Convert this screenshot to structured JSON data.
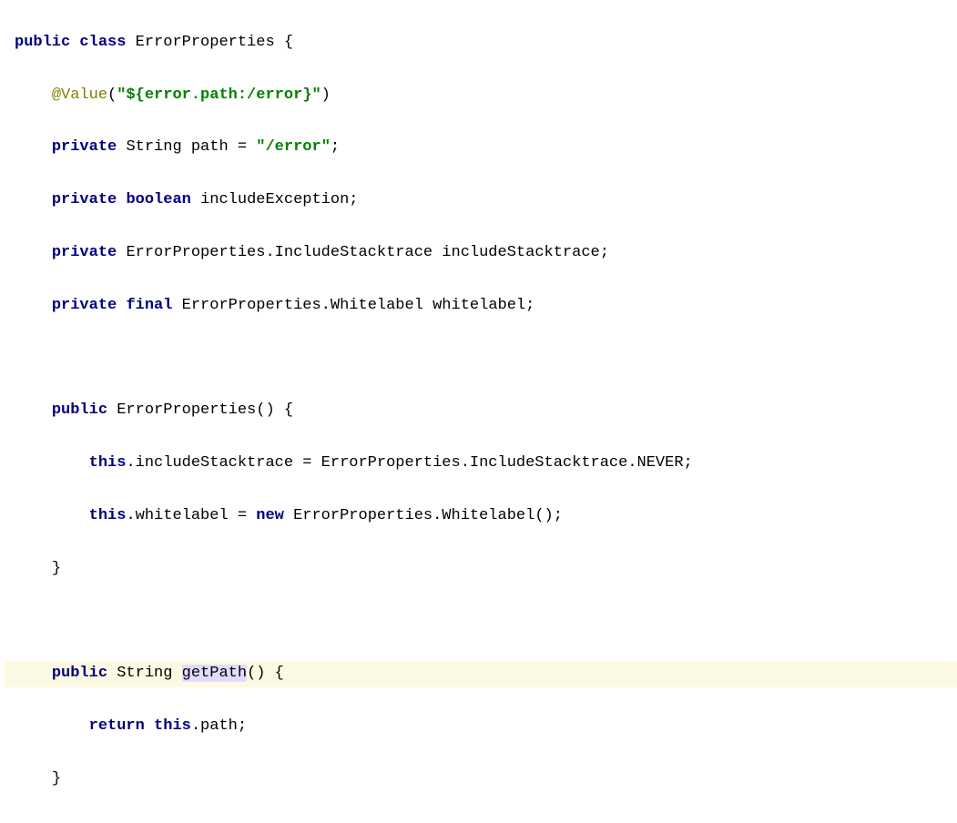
{
  "code": {
    "l1": {
      "kw1": "public",
      "kw2": "class",
      "name": "ErrorProperties",
      "brace": "{"
    },
    "l2": {
      "ann": "@Value",
      "open": "(",
      "str": "\"${error.path:/error}\"",
      "close": ")"
    },
    "l3": {
      "kw": "private",
      "type": "String",
      "name": "path",
      "eq": "=",
      "str": "\"/error\"",
      "semi": ";"
    },
    "l4": {
      "kw1": "private",
      "kw2": "boolean",
      "name": "includeException;"
    },
    "l5": {
      "kw": "private",
      "type": "ErrorProperties.IncludeStacktrace",
      "name": "includeStacktrace;"
    },
    "l6": {
      "kw1": "private",
      "kw2": "final",
      "type": "ErrorProperties.Whitelabel",
      "name": "whitelabel;"
    },
    "l8": {
      "kw": "public",
      "name": "ErrorProperties()",
      "brace": "{"
    },
    "l9": {
      "kw": "this",
      "text": ".includeStacktrace = ErrorProperties.IncludeStacktrace.NEVER;"
    },
    "l10": {
      "kw1": "this",
      "mid": ".whitelabel = ",
      "kw2": "new",
      "tail": " ErrorProperties.Whitelabel();"
    },
    "l11": {
      "brace": "}"
    },
    "l13": {
      "kw": "public",
      "type": "String ",
      "method": "getPath",
      "tail": "() {"
    },
    "l14": {
      "kw1": "return",
      "kw2": "this",
      "tail": ".path;"
    },
    "l15": {
      "brace": "}"
    }
  }
}
